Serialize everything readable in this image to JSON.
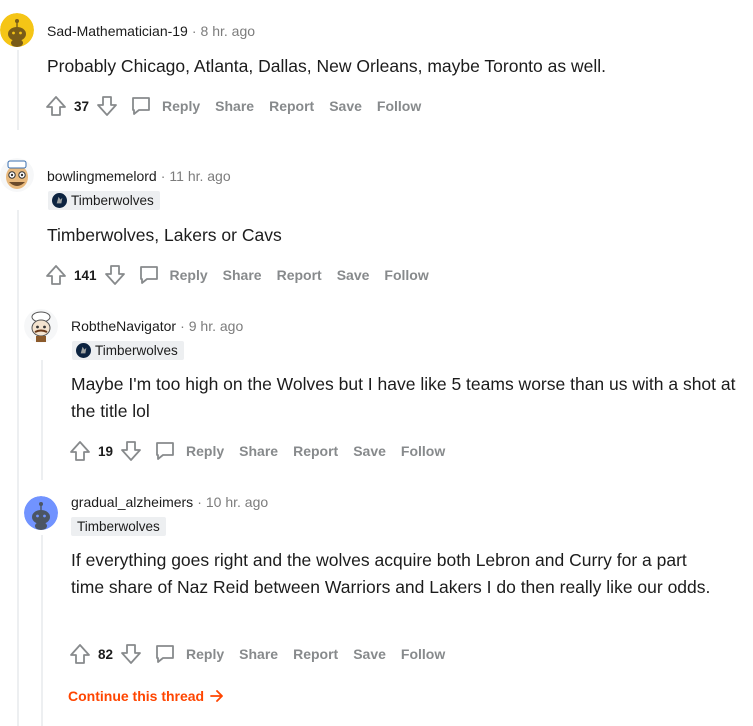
{
  "comments": [
    {
      "username": "Sad-Mathematician-19",
      "time": "8 hr. ago",
      "flair": "",
      "body": "Probably Chicago, Atlanta, Dallas, New Orleans, maybe Toronto as well.",
      "score": "37",
      "avatar": "snoo-yellow-icon"
    },
    {
      "username": "bowlingmemelord",
      "time": "11 hr. ago",
      "flair": "Timberwolves",
      "body": "Timberwolves, Lakers or Cavs",
      "score": "141",
      "avatar": "snoo-cartoon-icon"
    },
    {
      "username": "RobtheNavigator",
      "time": "9 hr. ago",
      "flair": "Timberwolves",
      "body": "Maybe I'm too high on the Wolves but I have like 5 teams worse than us with a shot at the title lol",
      "score": "19",
      "avatar": "snoo-chef-icon"
    },
    {
      "username": "gradual_alzheimers",
      "time": "10 hr. ago",
      "flair": "Timberwolves",
      "body": "If everything goes right and the wolves acquire both Lebron and Curry for a part time share of Naz Reid between Warriors and Lakers I do then really like our odds.",
      "score": "82",
      "avatar": "snoo-blue-icon"
    }
  ],
  "actions": {
    "reply": "Reply",
    "share": "Share",
    "report": "Report",
    "save": "Save",
    "follow": "Follow"
  },
  "meta": {
    "separator": "·"
  },
  "continue_thread": "Continue this thread",
  "colors": {
    "accent": "#ff4500",
    "muted": "#878a8c",
    "thread_line": "#edeff1",
    "flair_bg": "#edeff1"
  }
}
